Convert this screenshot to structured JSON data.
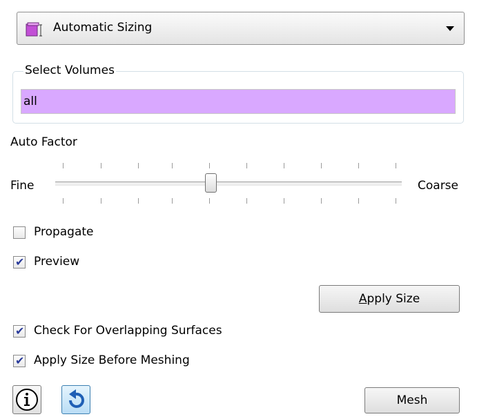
{
  "sizing_mode": {
    "selected": "Automatic Sizing",
    "icon": "volume-cube-icon"
  },
  "select_volumes": {
    "title": "Select Volumes",
    "value": "all",
    "highlight_color": "#d9a8ff"
  },
  "auto_factor": {
    "label": "Auto Factor",
    "min_label": "Fine",
    "max_label": "Coarse",
    "level": 0.45
  },
  "options": {
    "propagate": {
      "label": "Propagate",
      "checked": false
    },
    "preview": {
      "label": "Preview",
      "checked": true
    },
    "check_overlap": {
      "label": "Check For Overlapping Surfaces",
      "checked": true
    },
    "apply_before_mesh": {
      "label": "Apply Size Before Meshing",
      "checked": true
    }
  },
  "buttons": {
    "apply_size_label": "Apply Size",
    "apply_size_underline": "A",
    "apply_size_rest": "pply Size",
    "mesh_label": "Mesh",
    "info_icon": "info-icon",
    "reset_icon": "undo-icon"
  }
}
